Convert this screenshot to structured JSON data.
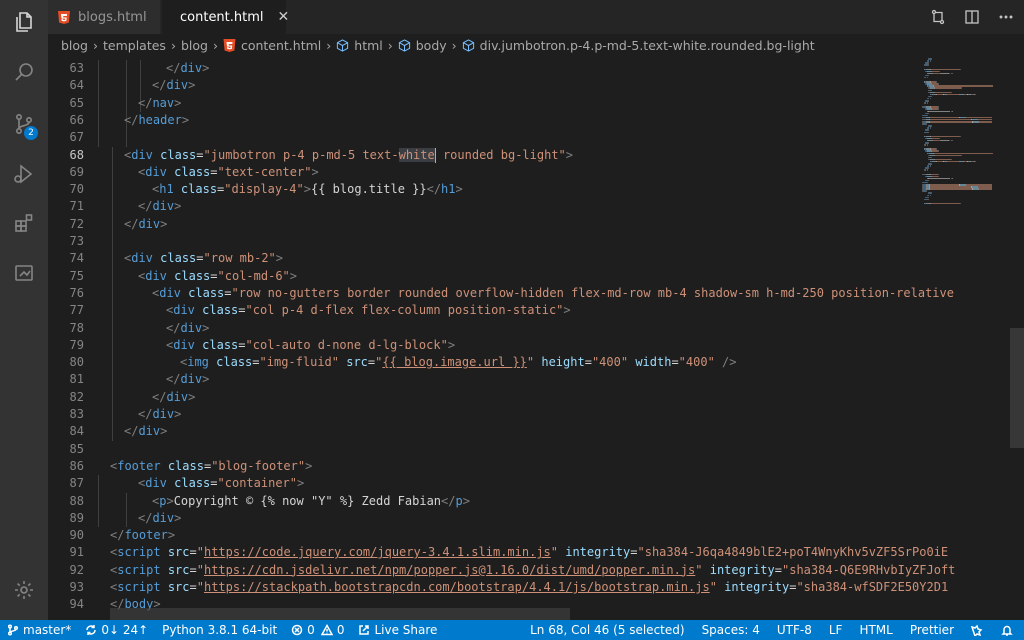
{
  "tabs": [
    {
      "label": "blogs.html",
      "active": false
    },
    {
      "label": "content.html",
      "active": true,
      "close": "✕"
    }
  ],
  "breadcrumb": {
    "items": [
      "blog",
      "templates",
      "blog",
      "content.html",
      "html",
      "body",
      "div.jumbotron.p-4.p-md-5.text-white.rounded.bg-light"
    ],
    "separator": "›"
  },
  "activity_bar": {
    "icons": [
      "explorer-icon",
      "search-icon",
      "source-control-icon",
      "run-debug-icon",
      "extensions-icon",
      "remote-explorer-icon",
      "manage-gear-icon"
    ],
    "source_control_badge": "2"
  },
  "editor": {
    "current_line": "68",
    "lines": [
      {
        "n": "63",
        "indent": 4,
        "tokens": [
          [
            "br",
            "</"
          ],
          [
            "tag",
            "div"
          ],
          [
            "br",
            ">"
          ]
        ]
      },
      {
        "n": "64",
        "indent": 3,
        "tokens": [
          [
            "br",
            "</"
          ],
          [
            "tag",
            "div"
          ],
          [
            "br",
            ">"
          ]
        ]
      },
      {
        "n": "65",
        "indent": 2,
        "tokens": [
          [
            "br",
            "</"
          ],
          [
            "tag",
            "nav"
          ],
          [
            "br",
            ">"
          ]
        ]
      },
      {
        "n": "66",
        "indent": 1,
        "tokens": [
          [
            "br",
            "</"
          ],
          [
            "tag",
            "header"
          ],
          [
            "br",
            ">"
          ]
        ]
      },
      {
        "n": "67",
        "indent": 0,
        "tokens": []
      },
      {
        "n": "68",
        "indent": 1,
        "tokens": [
          [
            "br",
            "<"
          ],
          [
            "tag",
            "div"
          ],
          [
            "txt",
            " "
          ],
          [
            "attr",
            "class"
          ],
          [
            "txt",
            "="
          ],
          [
            "str",
            "\"jumbotron p-4 p-md-5 text-"
          ],
          [
            "hl",
            "white"
          ],
          [
            "cursor",
            ""
          ],
          [
            "str",
            " rounded bg-light\""
          ],
          [
            "br",
            ">"
          ]
        ]
      },
      {
        "n": "69",
        "indent": 2,
        "tokens": [
          [
            "br",
            "<"
          ],
          [
            "tag",
            "div"
          ],
          [
            "txt",
            " "
          ],
          [
            "attr",
            "class"
          ],
          [
            "txt",
            "="
          ],
          [
            "str",
            "\"text-center\""
          ],
          [
            "br",
            ">"
          ]
        ]
      },
      {
        "n": "70",
        "indent": 3,
        "tokens": [
          [
            "br",
            "<"
          ],
          [
            "tag",
            "h1"
          ],
          [
            "txt",
            " "
          ],
          [
            "attr",
            "class"
          ],
          [
            "txt",
            "="
          ],
          [
            "str",
            "\"display-4\""
          ],
          [
            "br",
            ">"
          ],
          [
            "txt",
            "{{ blog.title }}"
          ],
          [
            "br",
            "</"
          ],
          [
            "tag",
            "h1"
          ],
          [
            "br",
            ">"
          ]
        ]
      },
      {
        "n": "71",
        "indent": 2,
        "tokens": [
          [
            "br",
            "</"
          ],
          [
            "tag",
            "div"
          ],
          [
            "br",
            ">"
          ]
        ]
      },
      {
        "n": "72",
        "indent": 1,
        "tokens": [
          [
            "br",
            "</"
          ],
          [
            "tag",
            "div"
          ],
          [
            "br",
            ">"
          ]
        ]
      },
      {
        "n": "73",
        "indent": 0,
        "tokens": []
      },
      {
        "n": "74",
        "indent": 1,
        "tokens": [
          [
            "br",
            "<"
          ],
          [
            "tag",
            "div"
          ],
          [
            "txt",
            " "
          ],
          [
            "attr",
            "class"
          ],
          [
            "txt",
            "="
          ],
          [
            "str",
            "\"row mb-2\""
          ],
          [
            "br",
            ">"
          ]
        ]
      },
      {
        "n": "75",
        "indent": 2,
        "tokens": [
          [
            "br",
            "<"
          ],
          [
            "tag",
            "div"
          ],
          [
            "txt",
            " "
          ],
          [
            "attr",
            "class"
          ],
          [
            "txt",
            "="
          ],
          [
            "str",
            "\"col-md-6\""
          ],
          [
            "br",
            ">"
          ]
        ]
      },
      {
        "n": "76",
        "indent": 3,
        "tokens": [
          [
            "br",
            "<"
          ],
          [
            "tag",
            "div"
          ],
          [
            "txt",
            " "
          ],
          [
            "attr",
            "class"
          ],
          [
            "txt",
            "="
          ],
          [
            "str",
            "\"row no-gutters border rounded overflow-hidden flex-md-row mb-4 shadow-sm h-md-250 position-relative"
          ]
        ]
      },
      {
        "n": "77",
        "indent": 4,
        "tokens": [
          [
            "br",
            "<"
          ],
          [
            "tag",
            "div"
          ],
          [
            "txt",
            " "
          ],
          [
            "attr",
            "class"
          ],
          [
            "txt",
            "="
          ],
          [
            "str",
            "\"col p-4 d-flex flex-column position-static\""
          ],
          [
            "br",
            ">"
          ]
        ]
      },
      {
        "n": "78",
        "indent": 4,
        "tokens": [
          [
            "br",
            "</"
          ],
          [
            "tag",
            "div"
          ],
          [
            "br",
            ">"
          ]
        ]
      },
      {
        "n": "79",
        "indent": 4,
        "tokens": [
          [
            "br",
            "<"
          ],
          [
            "tag",
            "div"
          ],
          [
            "txt",
            " "
          ],
          [
            "attr",
            "class"
          ],
          [
            "txt",
            "="
          ],
          [
            "str",
            "\"col-auto d-none d-lg-block\""
          ],
          [
            "br",
            ">"
          ]
        ]
      },
      {
        "n": "80",
        "indent": 5,
        "tokens": [
          [
            "br",
            "<"
          ],
          [
            "tag",
            "img"
          ],
          [
            "txt",
            " "
          ],
          [
            "attr",
            "class"
          ],
          [
            "txt",
            "="
          ],
          [
            "str",
            "\"img-fluid\""
          ],
          [
            "txt",
            " "
          ],
          [
            "attr",
            "src"
          ],
          [
            "txt",
            "="
          ],
          [
            "str",
            "\""
          ],
          [
            "url",
            "{{ blog.image.url }}"
          ],
          [
            "str",
            "\""
          ],
          [
            "txt",
            " "
          ],
          [
            "attr",
            "height"
          ],
          [
            "txt",
            "="
          ],
          [
            "str",
            "\"400\""
          ],
          [
            "txt",
            " "
          ],
          [
            "attr",
            "width"
          ],
          [
            "txt",
            "="
          ],
          [
            "str",
            "\"400\""
          ],
          [
            "txt",
            " "
          ],
          [
            "br",
            "/>"
          ]
        ]
      },
      {
        "n": "81",
        "indent": 4,
        "tokens": [
          [
            "br",
            "</"
          ],
          [
            "tag",
            "div"
          ],
          [
            "br",
            ">"
          ]
        ]
      },
      {
        "n": "82",
        "indent": 3,
        "tokens": [
          [
            "br",
            "</"
          ],
          [
            "tag",
            "div"
          ],
          [
            "br",
            ">"
          ]
        ]
      },
      {
        "n": "83",
        "indent": 2,
        "tokens": [
          [
            "br",
            "</"
          ],
          [
            "tag",
            "div"
          ],
          [
            "br",
            ">"
          ]
        ]
      },
      {
        "n": "84",
        "indent": 1,
        "tokens": [
          [
            "br",
            "</"
          ],
          [
            "tag",
            "div"
          ],
          [
            "br",
            ">"
          ]
        ]
      },
      {
        "n": "85",
        "indent": 0,
        "tokens": []
      },
      {
        "n": "86",
        "indent": 0,
        "tokens": [
          [
            "br",
            "<"
          ],
          [
            "tag",
            "footer"
          ],
          [
            "txt",
            " "
          ],
          [
            "attr",
            "class"
          ],
          [
            "txt",
            "="
          ],
          [
            "str",
            "\"blog-footer\""
          ],
          [
            "br",
            ">"
          ]
        ]
      },
      {
        "n": "87",
        "indent": 2,
        "tokens": [
          [
            "br",
            "<"
          ],
          [
            "tag",
            "div"
          ],
          [
            "txt",
            " "
          ],
          [
            "attr",
            "class"
          ],
          [
            "txt",
            "="
          ],
          [
            "str",
            "\"container\""
          ],
          [
            "br",
            ">"
          ]
        ]
      },
      {
        "n": "88",
        "indent": 3,
        "tokens": [
          [
            "br",
            "<"
          ],
          [
            "tag",
            "p"
          ],
          [
            "br",
            ">"
          ],
          [
            "txt",
            "Copyright © {% now \"Y\" %} Zedd Fabian"
          ],
          [
            "br",
            "</"
          ],
          [
            "tag",
            "p"
          ],
          [
            "br",
            ">"
          ]
        ]
      },
      {
        "n": "89",
        "indent": 2,
        "tokens": [
          [
            "br",
            "</"
          ],
          [
            "tag",
            "div"
          ],
          [
            "br",
            ">"
          ]
        ]
      },
      {
        "n": "90",
        "indent": 0,
        "tokens": [
          [
            "br",
            "</"
          ],
          [
            "tag",
            "footer"
          ],
          [
            "br",
            ">"
          ]
        ]
      },
      {
        "n": "91",
        "indent": 0,
        "tokens": [
          [
            "br",
            "<"
          ],
          [
            "tag",
            "script"
          ],
          [
            "txt",
            " "
          ],
          [
            "attr",
            "src"
          ],
          [
            "txt",
            "="
          ],
          [
            "str",
            "\""
          ],
          [
            "url",
            "https://code.jquery.com/jquery-3.4.1.slim.min.js"
          ],
          [
            "str",
            "\""
          ],
          [
            "txt",
            " "
          ],
          [
            "attr",
            "integrity"
          ],
          [
            "txt",
            "="
          ],
          [
            "str",
            "\"sha384-J6qa4849blE2+poT4WnyKhv5vZF5SrPo0iE"
          ]
        ]
      },
      {
        "n": "92",
        "indent": 0,
        "tokens": [
          [
            "br",
            "<"
          ],
          [
            "tag",
            "script"
          ],
          [
            "txt",
            " "
          ],
          [
            "attr",
            "src"
          ],
          [
            "txt",
            "="
          ],
          [
            "str",
            "\""
          ],
          [
            "url",
            "https://cdn.jsdelivr.net/npm/popper.js@1.16.0/dist/umd/popper.min.js"
          ],
          [
            "str",
            "\""
          ],
          [
            "txt",
            " "
          ],
          [
            "attr",
            "integrity"
          ],
          [
            "txt",
            "="
          ],
          [
            "str",
            "\"sha384-Q6E9RHvbIyZFJoft"
          ]
        ]
      },
      {
        "n": "93",
        "indent": 0,
        "tokens": [
          [
            "br",
            "<"
          ],
          [
            "tag",
            "script"
          ],
          [
            "txt",
            " "
          ],
          [
            "attr",
            "src"
          ],
          [
            "txt",
            "="
          ],
          [
            "str",
            "\""
          ],
          [
            "url",
            "https://stackpath.bootstrapcdn.com/bootstrap/4.4.1/js/bootstrap.min.js"
          ],
          [
            "str",
            "\""
          ],
          [
            "txt",
            " "
          ],
          [
            "attr",
            "integrity"
          ],
          [
            "txt",
            "="
          ],
          [
            "str",
            "\"sha384-wfSDF2E50Y2D1"
          ]
        ]
      },
      {
        "n": "94",
        "indent": 0,
        "tokens": [
          [
            "br",
            "</"
          ],
          [
            "tag",
            "body"
          ],
          [
            "br",
            ">"
          ]
        ]
      }
    ]
  },
  "status_bar": {
    "branch": "master*",
    "sync": "0↓ 24↑",
    "python": "Python 3.8.1 64-bit",
    "errors": "0",
    "warnings": "0",
    "live_share": "Live Share",
    "position": "Ln 68, Col 46 (5 selected)",
    "spaces": "Spaces: 4",
    "encoding": "UTF-8",
    "eol": "LF",
    "language": "HTML",
    "formatter": "Prettier"
  },
  "colors": {
    "accent": "#007acc",
    "tag": "#569cd6",
    "attr": "#9cdcfe",
    "string": "#ce9178",
    "html_icon": "#e44d26"
  }
}
